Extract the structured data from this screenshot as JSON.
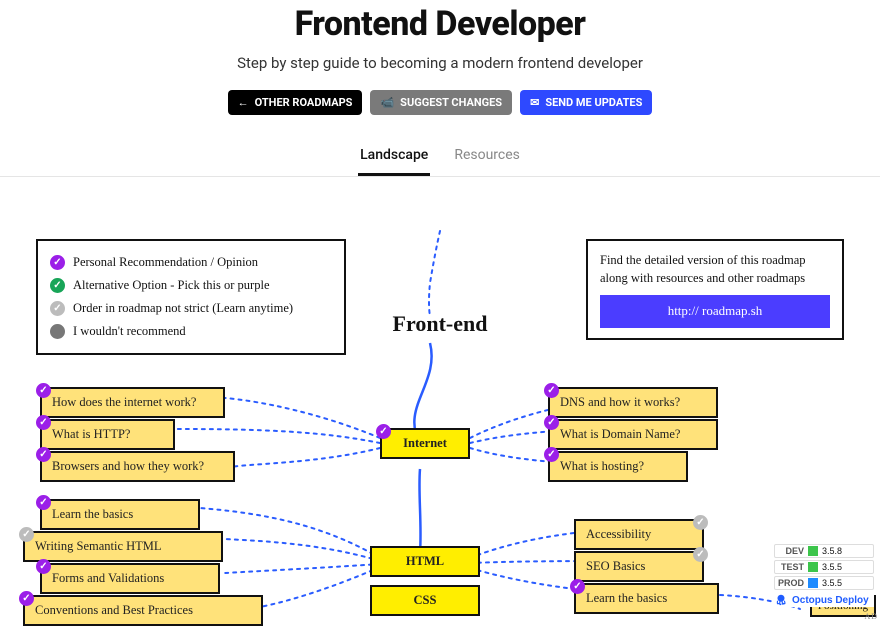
{
  "header": {
    "title": "Frontend Developer",
    "subtitle": "Step by step guide to becoming a modern frontend developer"
  },
  "buttons": {
    "other": "OTHER ROADMAPS",
    "suggest": "SUGGEST CHANGES",
    "updates": "SEND ME UPDATES"
  },
  "tabs": {
    "landscape": "Landscape",
    "resources": "Resources"
  },
  "legend": {
    "purple": "Personal Recommendation / Opinion",
    "green": "Alternative Option - Pick this or purple",
    "gray": "Order in roadmap not strict (Learn anytime)",
    "dark": "I wouldn't recommend"
  },
  "promo": {
    "text": "Find the detailed version of this roadmap along with resources and other roadmaps",
    "link": "http:// roadmap.sh"
  },
  "centerTitle": "Front-end",
  "nodes": {
    "internet": "Internet",
    "html": "HTML",
    "css": "CSS",
    "left_internet": [
      "How does the internet work?",
      "What is HTTP?",
      "Browsers and how they work?"
    ],
    "right_internet": [
      "DNS and how it works?",
      "What is Domain Name?",
      "What is hosting?"
    ],
    "left_html": [
      "Learn the basics",
      "Writing Semantic HTML",
      "Forms and Validations",
      "Conventions and Best Practices"
    ],
    "right_html": [
      "Accessibility",
      "SEO Basics",
      "Learn the basics"
    ],
    "positioning": "Positioning"
  },
  "ad": {
    "rows": [
      {
        "env": "DEV",
        "ver": "3.5.8",
        "c": "g"
      },
      {
        "env": "TEST",
        "ver": "3.5.5",
        "c": "g"
      },
      {
        "env": "PROD",
        "ver": "3.5.5",
        "c": "b"
      }
    ],
    "brand": "Octopus Deploy",
    "corner": "AD"
  }
}
